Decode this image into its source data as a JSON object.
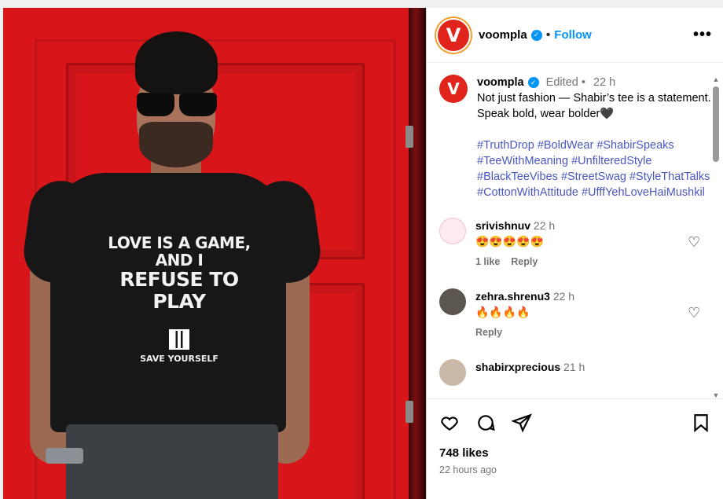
{
  "post": {
    "photo_shirt_text": {
      "line1": "LOVE IS A GAME,",
      "line2": "AND I",
      "line3": "REFUSE TO PLAY",
      "line4": "SAVE YOURSELF"
    }
  },
  "header": {
    "avatar_letter": "V",
    "username": "voompla",
    "separator": "•",
    "follow_label": "Follow",
    "more_label": "•••"
  },
  "caption": {
    "avatar_letter": "V",
    "username": "voompla",
    "edited": "Edited",
    "separator": "•",
    "time": "22 h",
    "text": "Not just fashion — Shabir’s tee is a statement. Speak bold, wear bolder🖤",
    "hashtags": "#TruthDrop #BoldWear #ShabirSpeaks #TeeWithMeaning #UnfilteredStyle #BlackTeeVibes #StreetSwag #StyleThatTalks #CottonWithAttitude #UfffYehLoveHaiMushkil"
  },
  "comments": [
    {
      "username": "srivishnuv",
      "time": "22 h",
      "text": "😍😍😍😍😍",
      "likes": "1 like",
      "reply": "Reply"
    },
    {
      "username": "zehra.shrenu3",
      "time": "22 h",
      "text": "🔥🔥🔥🔥",
      "reply": "Reply"
    },
    {
      "username": "shabirxprecious",
      "time": "21 h"
    }
  ],
  "footer": {
    "likes": "748 likes",
    "time_ago": "22 hours ago"
  },
  "colors": {
    "brand": "#e0241b",
    "link": "#0095f6",
    "hashtag": "#4a57c2"
  },
  "icons": [
    "heart-icon",
    "comment-icon",
    "share-icon",
    "bookmark-icon",
    "verified-icon",
    "more-icon"
  ]
}
